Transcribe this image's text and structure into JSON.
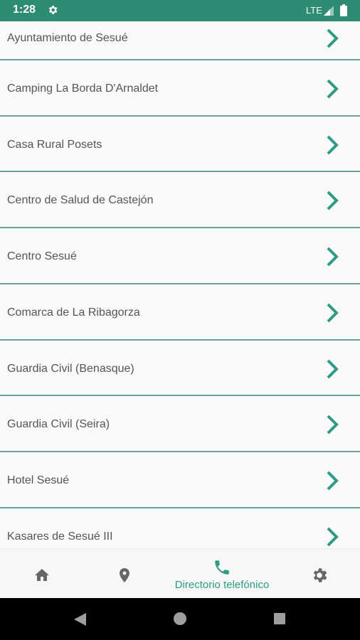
{
  "status_bar": {
    "time": "1:28",
    "network": "LTE",
    "settings_icon": "gear-icon",
    "signal_icon": "signal-icon",
    "battery_icon": "battery-icon"
  },
  "list": {
    "items": [
      {
        "label": "Ayuntamiento de Sesué"
      },
      {
        "label": "Camping La Borda D'Arnaldet"
      },
      {
        "label": "Casa Rural Posets"
      },
      {
        "label": "Centro de Salud de Castejón"
      },
      {
        "label": "Centro Sesué"
      },
      {
        "label": "Comarca de La Ribagorza"
      },
      {
        "label": "Guardia Civil (Benasque)"
      },
      {
        "label": "Guardia Civil (Seira)"
      },
      {
        "label": "Hotel Sesué"
      },
      {
        "label": "Kasares de Sesué III"
      }
    ],
    "chevron_icon": "chevron-right-icon"
  },
  "bottom_nav": {
    "items": [
      {
        "icon": "home-icon",
        "label": ""
      },
      {
        "icon": "location-pin-icon",
        "label": ""
      },
      {
        "icon": "phone-icon",
        "label": "Directorio telefónico"
      },
      {
        "icon": "gear-icon",
        "label": ""
      }
    ],
    "active_color": "#2e9c84"
  },
  "system_nav": {
    "back_icon": "back-triangle-icon",
    "home_icon": "home-circle-icon",
    "recents_icon": "recents-square-icon"
  },
  "colors": {
    "status_bar": "#2e8c75",
    "accent": "#2e9c84",
    "divider": "#6aa19a"
  }
}
